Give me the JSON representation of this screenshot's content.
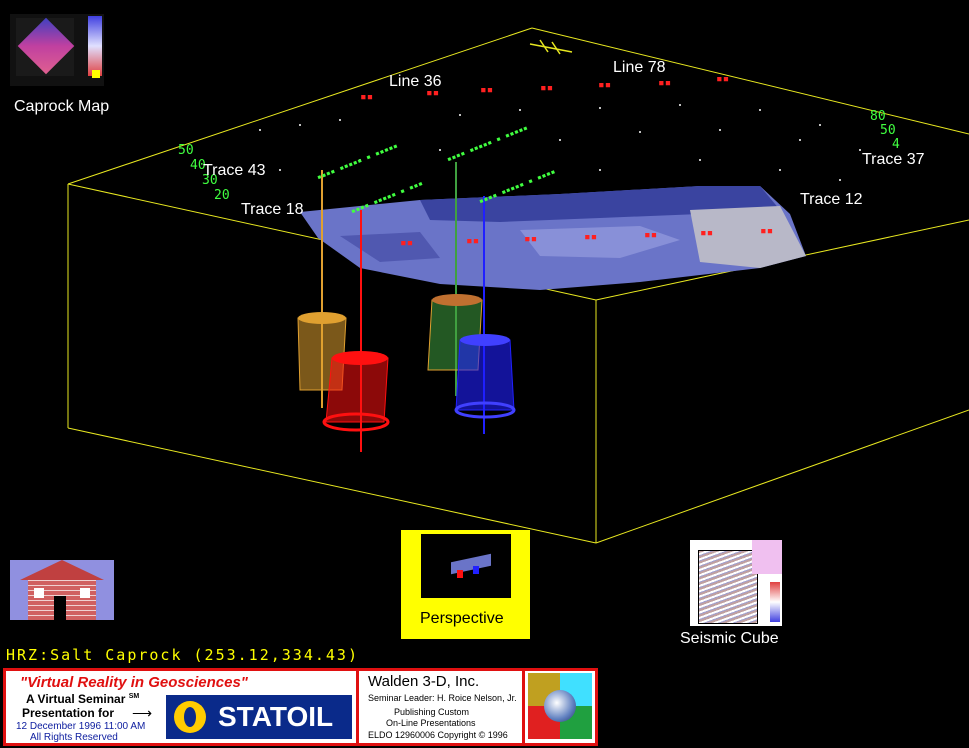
{
  "labels": {
    "caprock_map": "Caprock Map",
    "line_36": "Line 36",
    "line_78": "Line 78",
    "trace_43": "Trace 43",
    "trace_18": "Trace 18",
    "trace_37": "Trace 37",
    "trace_12": "Trace 12",
    "perspective": "Perspective",
    "seismic_cube": "Seismic Cube"
  },
  "axis_numbers": {
    "left": [
      "50",
      "40",
      "30",
      "20"
    ],
    "right": [
      "80",
      "50",
      "4"
    ]
  },
  "status": {
    "horizon_readout": "HRZ:Salt Caprock (253.12,334.43)"
  },
  "banner": {
    "title": "\"Virtual Reality in Geosciences\"",
    "line1": "A Virtual Seminar",
    "sm": "SM",
    "line2": "Presentation for",
    "date": "12 December 1996  11:00 AM",
    "rights": "All Rights Reserved",
    "sponsor": "STATOIL",
    "company": "Walden 3-D, Inc.",
    "leader": "Seminar Leader: H. Roice Nelson, Jr.",
    "pub1": "Publishing Custom",
    "pub2": "On-Line Presentations",
    "copyright": "ELDO 12960006 Copyright © 1996"
  },
  "colors": {
    "box_edge": "#e8e820",
    "well_orange": "#e0a030",
    "well_red": "#ff1010",
    "well_green": "#40a040",
    "well_blue": "#2020ff",
    "surface": "#6a74c8",
    "accent_yellow": "#ffff00"
  }
}
